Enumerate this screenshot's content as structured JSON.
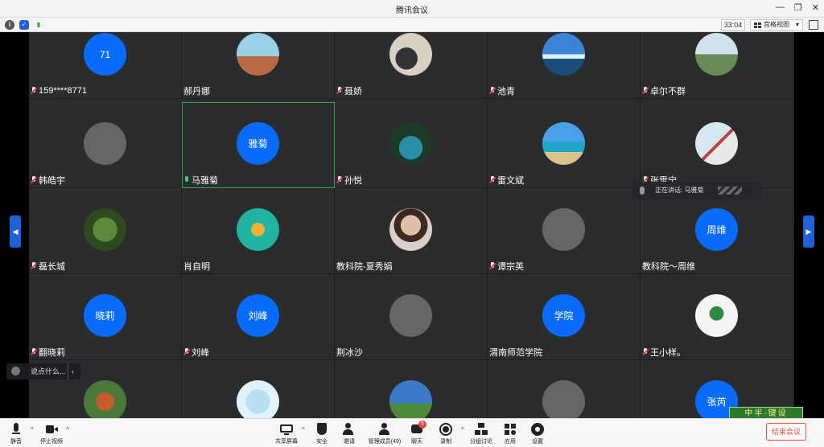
{
  "window": {
    "title": "腾讯会议"
  },
  "infobar": {
    "timer": "33:04",
    "view_label": "宫格视图"
  },
  "grid": {
    "tiles": [
      {
        "name": "159****8771",
        "avatar_text": "71",
        "avatar_kind": "text",
        "mic": "muted"
      },
      {
        "name": "郝丹娜",
        "avatar_text": "",
        "avatar_kind": "photo",
        "mic": "none"
      },
      {
        "name": "聂娇",
        "avatar_text": "",
        "avatar_kind": "photo",
        "mic": "muted"
      },
      {
        "name": "池青",
        "avatar_text": "",
        "avatar_kind": "photo",
        "mic": "muted"
      },
      {
        "name": "卓尔不群",
        "avatar_text": "",
        "avatar_kind": "photo",
        "mic": "muted"
      },
      {
        "name": "韩皓宇",
        "avatar_text": "",
        "avatar_kind": "photo",
        "mic": "muted"
      },
      {
        "name": "马雅菊",
        "avatar_text": "雅菊",
        "avatar_kind": "text",
        "mic": "active"
      },
      {
        "name": "孙悦",
        "avatar_text": "",
        "avatar_kind": "photo",
        "mic": "muted"
      },
      {
        "name": "雷文斌",
        "avatar_text": "",
        "avatar_kind": "photo",
        "mic": "muted"
      },
      {
        "name": "张雪宁",
        "avatar_text": "",
        "avatar_kind": "photo",
        "mic": "muted"
      },
      {
        "name": "磊长城",
        "avatar_text": "",
        "avatar_kind": "photo",
        "mic": "muted"
      },
      {
        "name": "肖自明",
        "avatar_text": "",
        "avatar_kind": "photo",
        "mic": "none"
      },
      {
        "name": "教科院-夏秀娟",
        "avatar_text": "",
        "avatar_kind": "photo",
        "mic": "none"
      },
      {
        "name": "谭宗英",
        "avatar_text": "",
        "avatar_kind": "photo",
        "mic": "muted"
      },
      {
        "name": "教科院～周维",
        "avatar_text": "周维",
        "avatar_kind": "text",
        "mic": "none"
      },
      {
        "name": "翻晓莉",
        "avatar_text": "晓莉",
        "avatar_kind": "text",
        "mic": "muted"
      },
      {
        "name": "刘峰",
        "avatar_text": "刘峰",
        "avatar_kind": "text",
        "mic": "muted"
      },
      {
        "name": "荆冰沙",
        "avatar_text": "",
        "avatar_kind": "photo",
        "mic": "none"
      },
      {
        "name": "渭南师范学院",
        "avatar_text": "学院",
        "avatar_kind": "text",
        "mic": "none"
      },
      {
        "name": "王小样。",
        "avatar_text": "",
        "avatar_kind": "photo",
        "mic": "muted"
      },
      {
        "name": "",
        "avatar_text": "",
        "avatar_kind": "photo",
        "mic": "none"
      },
      {
        "name": "",
        "avatar_text": "",
        "avatar_kind": "photo",
        "mic": "none"
      },
      {
        "name": "",
        "avatar_text": "",
        "avatar_kind": "photo",
        "mic": "none"
      },
      {
        "name": "",
        "avatar_text": "",
        "avatar_kind": "photo",
        "mic": "none"
      },
      {
        "name": "",
        "avatar_text": "张芮",
        "avatar_kind": "text",
        "mic": "none"
      }
    ]
  },
  "speaking": {
    "label": "正在讲话: 马雅菊"
  },
  "chat": {
    "placeholder": "说点什么..."
  },
  "toolbar": {
    "mute": "静音",
    "stop_video": "停止视频",
    "share": "共享屏幕",
    "security": "安全",
    "invite": "邀请",
    "members": "管理成员(49)",
    "chat": "聊天",
    "chat_badge": "5",
    "record": "录制",
    "breakout": "分组讨论",
    "apps": "应用",
    "settings": "设置",
    "end": "结束会议"
  },
  "watermark": {
    "text": "中半·键设"
  },
  "colors": {
    "accent": "#0a6cff",
    "active_border": "#3fa34d",
    "end_red": "#e74c3c",
    "tile_bg": "#2b2c2e"
  },
  "icons": [
    "info-icon",
    "shield-icon",
    "signal-icon",
    "grid-view-icon",
    "fullscreen-icon",
    "mic-icon",
    "video-icon",
    "share-screen-icon",
    "security-icon",
    "invite-icon",
    "members-icon",
    "chat-icon",
    "record-icon",
    "breakout-icon",
    "apps-icon",
    "settings-icon"
  ]
}
